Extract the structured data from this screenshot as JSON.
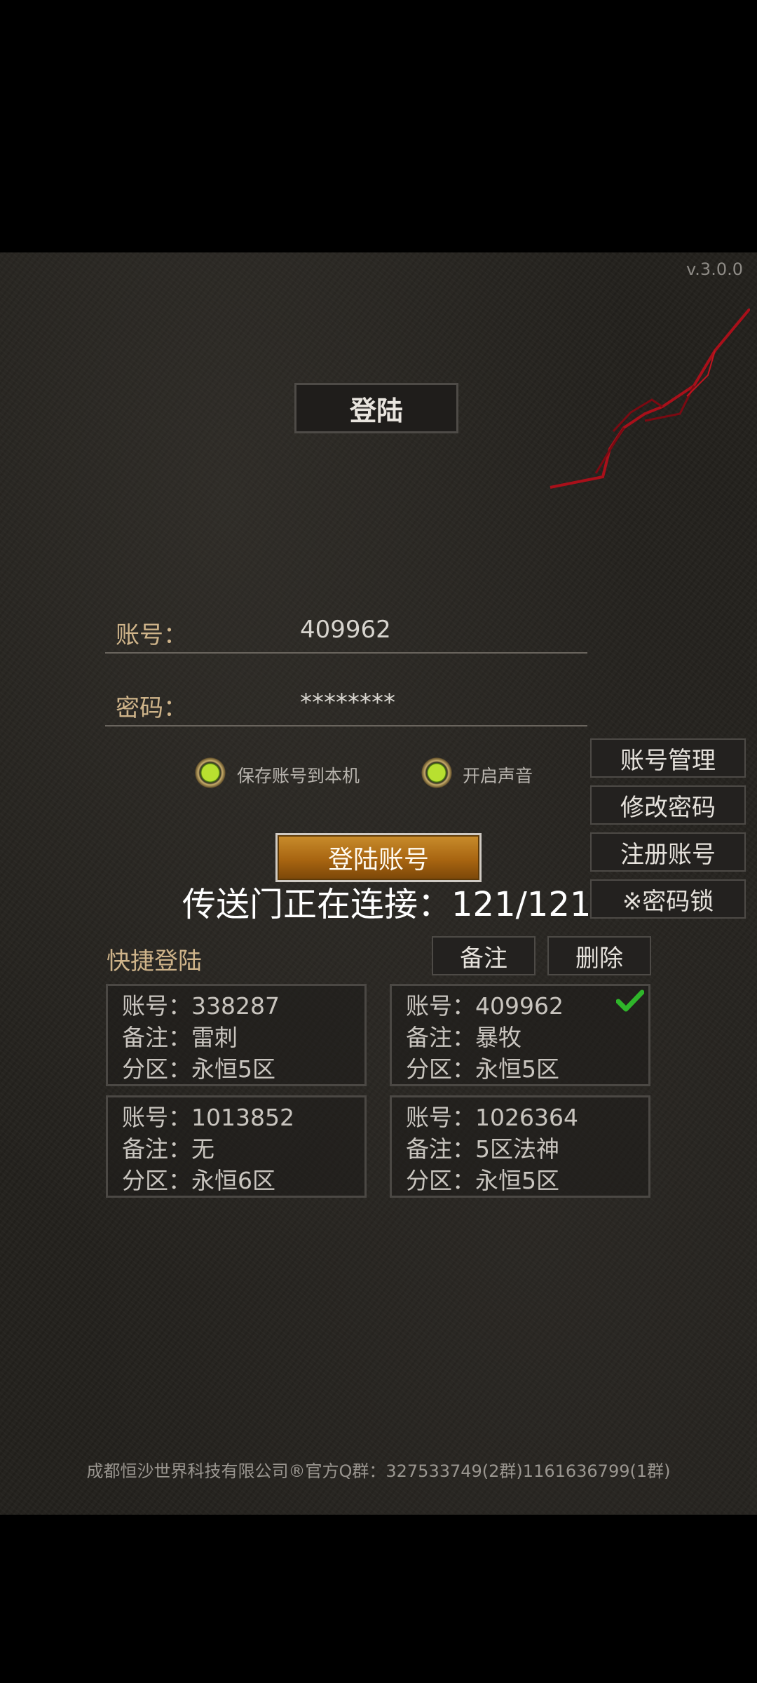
{
  "version": "v.3.0.0",
  "title": "登陆",
  "account": {
    "label": "账号：",
    "value": "409962"
  },
  "password": {
    "label": "密码：",
    "value": "********"
  },
  "options": {
    "save_account": "保存账号到本机",
    "sound": "开启声音"
  },
  "side_buttons": {
    "manage": "账号管理",
    "change_password": "修改密码",
    "register": "注册账号",
    "password_lock": "※密码锁"
  },
  "login_button": "登陆账号",
  "status": "传送门正在连接：121/121",
  "quick_login": {
    "title": "快捷登陆",
    "note_button": "备注",
    "delete_button": "删除",
    "cards": [
      {
        "account": "账号：338287",
        "note": "备注：雷刺",
        "zone": "分区：永恒5区"
      },
      {
        "account": "账号：409962",
        "note": "备注：暴牧",
        "zone": "分区：永恒5区",
        "selected": true
      },
      {
        "account": "账号：1013852",
        "note": "备注：无",
        "zone": "分区：永恒6区"
      },
      {
        "account": "账号：1026364",
        "note": "备注：5区法神",
        "zone": "分区：永恒5区"
      }
    ]
  },
  "footer": "成都恒沙世界科技有限公司®官方Q群：327533749(2群)1161636799(1群)",
  "colors": {
    "accent_gold": "#cfb48a",
    "button_orange": "#a86511",
    "check_green": "#2fb52a",
    "crack_red": "#a8101a"
  }
}
